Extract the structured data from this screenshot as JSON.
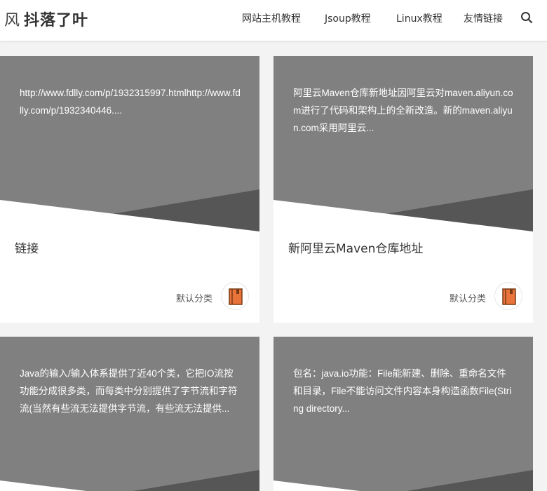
{
  "site": {
    "logo_char": "风",
    "logo_text": "抖落了叶"
  },
  "nav": {
    "items": [
      {
        "label": "网站主机教程"
      },
      {
        "label": "Jsoup教程"
      },
      {
        "label": "Linux教程"
      },
      {
        "label": "友情链接"
      }
    ]
  },
  "icons": {
    "search": "search-icon",
    "category": "book-icon"
  },
  "colors": {
    "banner": "#808080",
    "banner_dark": "#565656",
    "book_icon": "#e8743b"
  },
  "posts": [
    {
      "excerpt": "http://www.fdlly.com/p/1932315997.htmlhttp://www.fdlly.com/p/1932340446....",
      "title": "链接",
      "category": "默认分类"
    },
    {
      "excerpt": "阿里云Maven仓库新地址因阿里云对maven.aliyun.com进行了代码和架构上的全新改造。新的maven.aliyun.com采用阿里云...",
      "title": "新阿里云Maven仓库地址",
      "category": "默认分类"
    },
    {
      "excerpt": "Java的输入/输入体系提供了近40个类，它把IO流按功能分成很多类，而每类中分别提供了字节流和字符流(当然有些流无法提供字节流，有些流无法提供...",
      "title": "",
      "category": ""
    },
    {
      "excerpt": "包名：java.io功能：File能新建、删除、重命名文件和目录，File不能访问文件内容本身构造函数File(String directory...",
      "title": "",
      "category": ""
    }
  ]
}
